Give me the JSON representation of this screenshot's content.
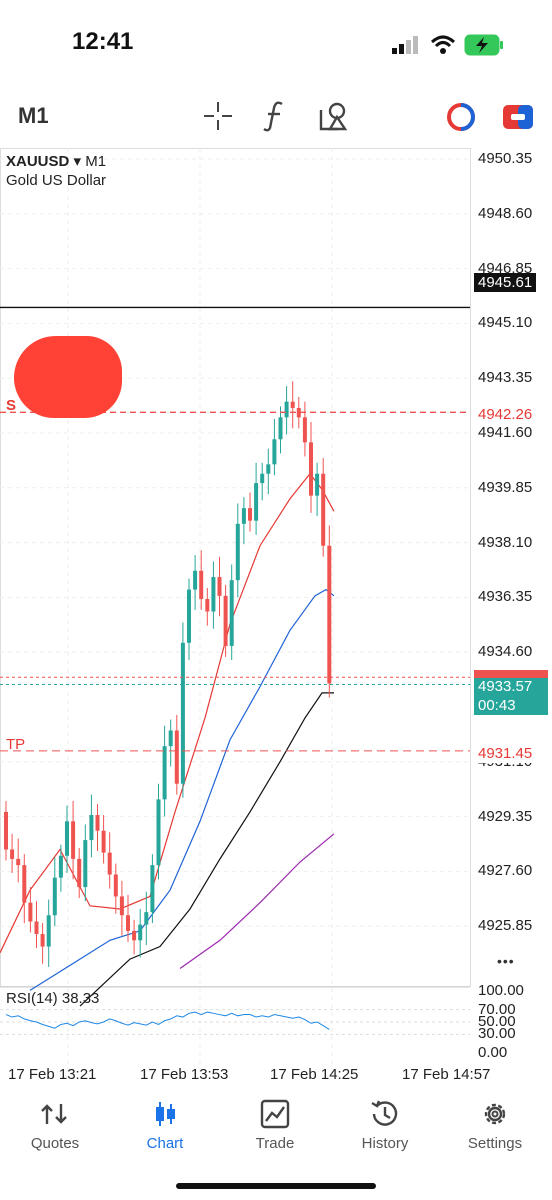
{
  "status": {
    "time": "12:41"
  },
  "toolbar": {
    "timeframe": "M1",
    "icons": [
      "crosshair-icon",
      "function-icon",
      "objects-icon",
      "color-scheme-icon",
      "chart-type-icon"
    ]
  },
  "chart": {
    "symbol": "XAUUSD",
    "symbol_tf": "▾ M1",
    "symbol_desc": "Gold US Dollar",
    "price_ticks": [
      "4950.35",
      "4948.60",
      "4946.85",
      "4945.10",
      "4943.35",
      "4941.60",
      "4939.85",
      "4938.10",
      "4936.35",
      "4934.60",
      "4931.10",
      "4929.35",
      "4927.60",
      "4925.85"
    ],
    "line_tag": "4945.61",
    "sl_tag": "4942.26",
    "sl_label": "S",
    "bid_tag": "4933.57",
    "countdown": "00:43",
    "tp_label": "TP",
    "tp_tag": "4931.45",
    "more_label": "•••",
    "rsi_label": "RSI(14)  38.33",
    "rsi_ticks": [
      "100.00",
      "70.00",
      "50.00",
      "30.00",
      "0.00"
    ],
    "date_ticks": [
      "17 Feb 13:21",
      "17 Feb 13:53",
      "17 Feb 14:25",
      "17 Feb 14:57"
    ],
    "colors": {
      "bull": "#26a69a",
      "bear": "#ef5350",
      "ma_fast": "#e53935",
      "ma_mid": "#1e63d6",
      "ma_slow": "#111111",
      "ma_long": "#9c27b0",
      "rsi": "#1e88e5"
    }
  },
  "tabs": [
    {
      "label": "Quotes",
      "icon": "quotes-icon"
    },
    {
      "label": "Chart",
      "icon": "chart-icon"
    },
    {
      "label": "Trade",
      "icon": "trade-icon"
    },
    {
      "label": "History",
      "icon": "history-icon"
    },
    {
      "label": "Settings",
      "icon": "settings-icon"
    }
  ]
}
